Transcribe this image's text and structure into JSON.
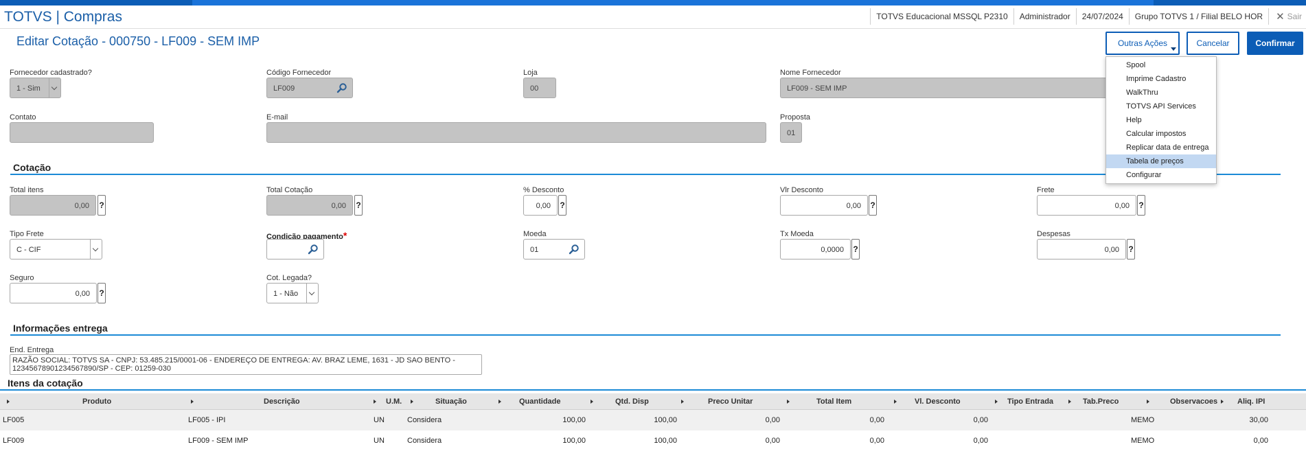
{
  "app": {
    "title": "TOTVS | Compras",
    "environment": "TOTVS Educacional MSSQL P2310",
    "user": "Administrador",
    "date": "24/07/2024",
    "branch": "Grupo TOTVS 1 / Filial BELO HOR",
    "exit_label": "Sair"
  },
  "page": {
    "title": "Editar Cotação -  000750 - LF009 - SEM IMP"
  },
  "actions": {
    "more_label": "Outras Ações",
    "cancel_label": "Cancelar",
    "confirm_label": "Confirmar",
    "menu": [
      "Spool",
      "Imprime Cadastro",
      "WalkThru",
      "TOTVS API Services",
      "Help",
      "Calcular impostos",
      "Replicar data de entrega",
      "Tabela de preços",
      "Configurar"
    ],
    "menu_highlighted": "Tabela de preços"
  },
  "header": {
    "fornecedor_cadastrado": {
      "label": "Fornecedor cadastrado?",
      "value": "1 - Sim"
    },
    "codigo_fornecedor": {
      "label": "Código Fornecedor",
      "value": "LF009"
    },
    "loja": {
      "label": "Loja",
      "value": "00"
    },
    "nome_fornecedor": {
      "label": "Nome Fornecedor",
      "value": "LF009 - SEM IMP"
    },
    "contato": {
      "label": "Contato",
      "value": ""
    },
    "email": {
      "label": "E-mail",
      "value": ""
    },
    "proposta": {
      "label": "Proposta",
      "value": "01"
    }
  },
  "cotacao": {
    "section": "Cotação",
    "total_itens": {
      "label": "Total itens",
      "value": "0,00"
    },
    "total_cotacao": {
      "label": "Total Cotação",
      "value": "0,00"
    },
    "desconto": {
      "label": "% Desconto",
      "value": "0,00"
    },
    "vlr_desconto": {
      "label": "Vlr Desconto",
      "value": "0,00"
    },
    "frete": {
      "label": "Frete",
      "value": "0,00"
    },
    "tipo_frete": {
      "label": "Tipo Frete",
      "value": "C - CIF"
    },
    "condicao_pagamento": {
      "label": "Condição pagamento",
      "required": "*",
      "value": ""
    },
    "moeda": {
      "label": "Moeda",
      "value": "01"
    },
    "tx_moeda": {
      "label": "Tx Moeda",
      "value": "0,0000"
    },
    "despesas": {
      "label": "Despesas",
      "value": "0,00"
    },
    "seguro": {
      "label": "Seguro",
      "value": "0,00"
    },
    "cot_legada": {
      "label": "Cot. Legada?",
      "value": "1 - Não"
    },
    "help_glyph": "?"
  },
  "entrega": {
    "section": "Informações entrega",
    "end_label": "End. Entrega",
    "end_value": "RAZÃO SOCIAL: TOTVS SA - CNPJ: 53.485.215/0001-06 - ENDEREÇO DE ENTREGA: AV. BRAZ LEME, 1631 - JD SAO BENTO - 12345678901234567890/SP - CEP: 01259-030"
  },
  "itens": {
    "section": "Itens da cotação",
    "columns": [
      "Produto",
      "Descrição",
      "U.M.",
      "Situação",
      "Quantidade",
      "Qtd. Disp",
      "Preco Unitar",
      "Total Item",
      "Vl. Desconto",
      "Tipo Entrada",
      "Tab.Preco",
      "Observacoes",
      "Aliq. IPI"
    ],
    "rows": [
      [
        "LF005",
        "LF005 - IPI",
        "UN",
        "Considera",
        "100,00",
        "100,00",
        "0,00",
        "0,00",
        "0,00",
        "",
        "",
        "MEMO",
        "30,00"
      ],
      [
        "LF009",
        "LF009 - SEM IMP",
        "UN",
        "Considera",
        "100,00",
        "100,00",
        "0,00",
        "0,00",
        "0,00",
        "",
        "",
        "MEMO",
        "0,00"
      ]
    ]
  }
}
